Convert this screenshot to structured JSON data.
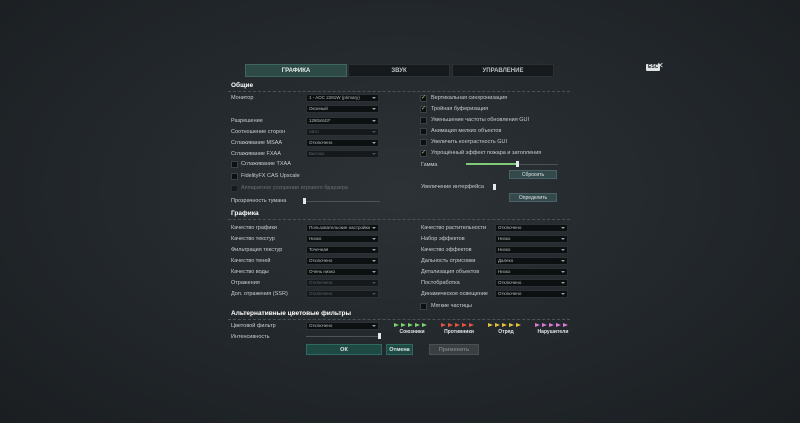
{
  "tabs": [
    {
      "label": "ГРАФИКА",
      "active": true
    },
    {
      "label": "ЗВУК",
      "active": false
    },
    {
      "label": "УПРАВЛЕНИЕ",
      "active": false
    }
  ],
  "esc_label": "ESC",
  "close_glyph": "✕",
  "general": {
    "title": "Общие",
    "monitor": {
      "label": "Монитор",
      "value": "1 - AOC 2281W (primary)",
      "mode": "Оконный"
    },
    "resolution": {
      "label": "Разрешение",
      "value": "1280x843*"
    },
    "aspect": {
      "label": "Соотношение сторон",
      "value": "Авто"
    },
    "msaa": {
      "label": "Сглаживание MSAA",
      "value": "Отключено"
    },
    "fxaa": {
      "label": "Сглаживание FXAA",
      "value": "Высоко"
    },
    "txaa": {
      "label": "Сглаживание TXAA",
      "checked": false
    },
    "fidelity": {
      "label": "FidelityFX CAS Upscale",
      "checked": false
    },
    "browser_accel": {
      "label": "Аппаратное ускорение игрового браузера",
      "checked": false
    },
    "fog": {
      "label": "Прозрачность тумана",
      "level": 0.0
    },
    "vsync": {
      "label": "Вертикальная синхронизация",
      "checked": true
    },
    "triple_buffer": {
      "label": "Тройная буферизация",
      "checked": true
    },
    "gui_refresh": {
      "label": "Уменьшение частоты обновления GUI",
      "checked": false
    },
    "small_anim": {
      "label": "Анимация мелких объектов",
      "checked": false
    },
    "gui_contrast": {
      "label": "Увеличить контрастность GUI",
      "checked": false
    },
    "simple_fire": {
      "label": "Упрощённый эффект пожара и затопления",
      "checked": true
    },
    "gamma": {
      "label": "Гамма",
      "level": 0.55,
      "reset_label": "Сбросить"
    },
    "ui_scale": {
      "label": "Увеличение интерфейса",
      "detect_label": "Определить"
    }
  },
  "graphics": {
    "title": "Графика",
    "left": [
      {
        "label": "Качество графики",
        "value": "Пользовательские настройки",
        "dim": false
      },
      {
        "label": "Качество текстур",
        "value": "Низко",
        "dim": false
      },
      {
        "label": "Фильтрация текстур",
        "value": "Точечная",
        "dim": false
      },
      {
        "label": "Качество теней",
        "value": "Отключено",
        "dim": false
      },
      {
        "label": "Качество воды",
        "value": "Очень низко",
        "dim": false
      },
      {
        "label": "Отражения",
        "value": "Отключено",
        "dim": true
      },
      {
        "label": "Доп. отражения (SSR)",
        "value": "Отключено",
        "dim": true
      }
    ],
    "right": [
      {
        "label": "Качество растительности",
        "value": "Отключено"
      },
      {
        "label": "Набор эффектов",
        "value": "Низко"
      },
      {
        "label": "Качество эффектов",
        "value": "Низко"
      },
      {
        "label": "Дальность отрисовки",
        "value": "Далеко"
      },
      {
        "label": "Детализация объектов",
        "value": "Низко"
      },
      {
        "label": "Постобработка",
        "value": "Отключено"
      },
      {
        "label": "Динамическое освещение",
        "value": "Отключено"
      }
    ],
    "soft_particles": {
      "label": "Мягкие частицы",
      "checked": false
    }
  },
  "color_filters": {
    "title": "Альтернативные цветовые фильтры",
    "filter": {
      "label": "Цветовой фильтр",
      "value": "Отключено"
    },
    "intensity": {
      "label": "Интенсивность",
      "level": 0.0
    },
    "legend": [
      {
        "label": "Союзники",
        "color": "#7bd66f"
      },
      {
        "label": "Противники",
        "color": "#e8553e"
      },
      {
        "label": "Отряд",
        "color": "#e8c23e"
      },
      {
        "label": "Нарушители",
        "color": "#e07ad8"
      }
    ]
  },
  "footer": {
    "ok_label": "ОК",
    "cancel_label": "Отмена",
    "apply_label": "Применить"
  }
}
